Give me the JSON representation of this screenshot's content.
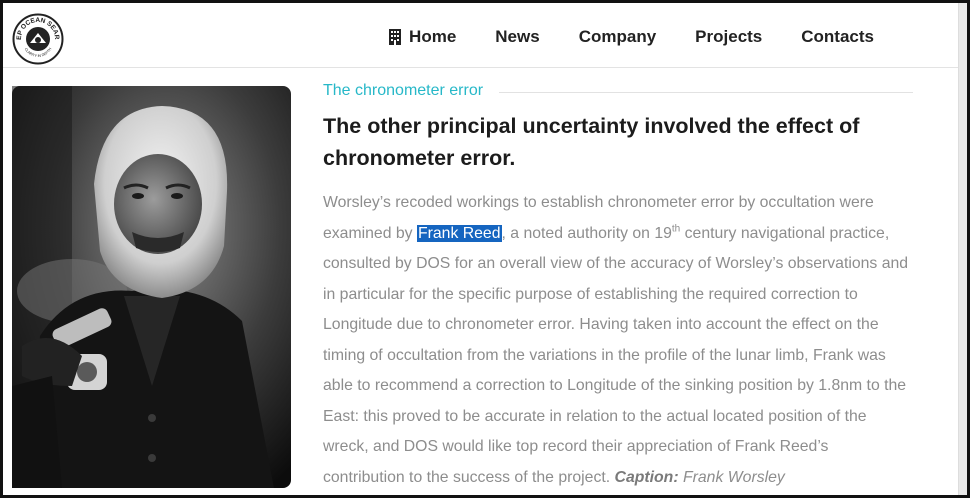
{
  "header": {
    "logo_text_top": "DEEP OCEAN SEARCH",
    "logo_text_bottom": "CLARITY IN DEPTH",
    "nav": [
      {
        "label": "Home",
        "icon": "building-icon"
      },
      {
        "label": "News"
      },
      {
        "label": "Company"
      },
      {
        "label": "Projects"
      },
      {
        "label": "Contacts"
      }
    ]
  },
  "article": {
    "kicker": "The chronometer error",
    "heading": "The other principal uncertainty involved the effect of chronometer error.",
    "p_part1": "Worsley’s recoded workings to establish chronometer error by occultation were examined by ",
    "highlight_name": "Frank Reed",
    "p_part2": ", a noted authority on 19",
    "sup": "th",
    "p_part3": " century navigational practice, consulted by DOS for an overall view of the accuracy of Worsley’s observations and in particular for the specific purpose of establishing the required correction to Longitude due to chronometer error. Having taken into account the effect on the timing of occultation from the variations in the profile of the lunar limb, Frank was able to recommend a correction to Longitude of the sinking position by 1.8nm to the East: this proved to be accurate in relation to the actual located position of the wreck, and DOS would like top record their appreciation of Frank Reed’s contribution to the success of the project.",
    "caption_label": "Caption:",
    "caption_text": "Frank Worsley"
  },
  "colors": {
    "accent": "#27b8c8",
    "highlight": "#1565c0",
    "body_text": "#8d8d8d",
    "heading": "#1c1c1c"
  }
}
